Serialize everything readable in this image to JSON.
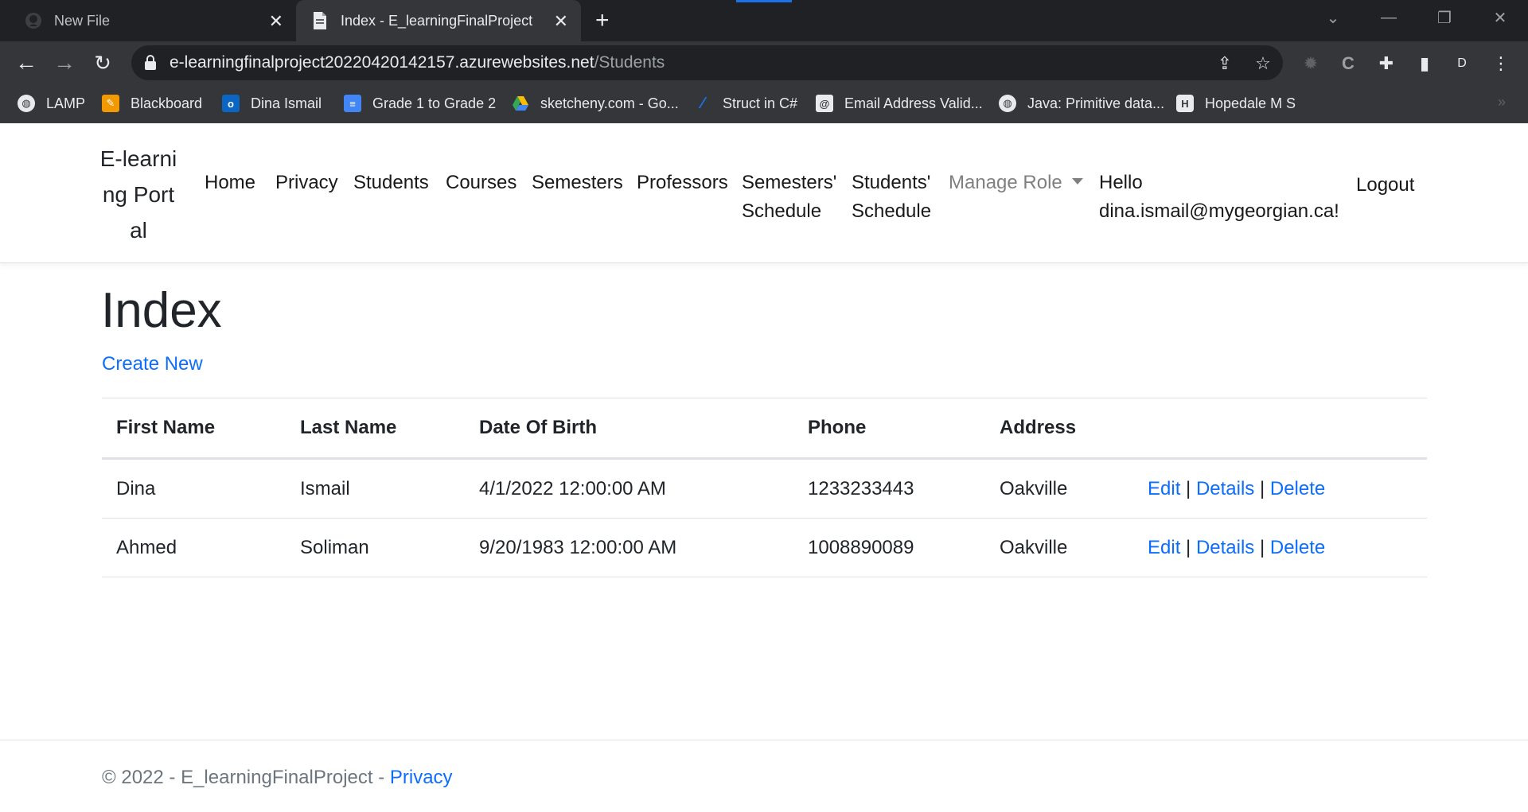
{
  "browser": {
    "tabs": [
      {
        "title": "New File",
        "icon": "github-icon",
        "active": false
      },
      {
        "title": "Index - E_learningFinalProject",
        "icon": "document-icon",
        "active": true
      }
    ],
    "url_host": "e-learningfinalproject20220420142157.azurewebsites.net",
    "url_path": "/Students",
    "profile_initial": "D",
    "bookmarks": [
      {
        "label": "LAMP",
        "icon": "globe-icon",
        "color": "#e8eaed"
      },
      {
        "label": "Blackboard",
        "icon": "pencil-icon",
        "color": "#f29900"
      },
      {
        "label": "Dina Ismail",
        "icon": "outlook-icon",
        "color": "#0a66c2"
      },
      {
        "label": "Grade 1 to Grade 2",
        "icon": "docs-icon",
        "color": "#4285f4"
      },
      {
        "label": "sketcheny.com - Go...",
        "icon": "drive-icon",
        "color": "#34a853"
      },
      {
        "label": "Struct in C#",
        "icon": "feather-icon",
        "color": "#1a73e8"
      },
      {
        "label": "Email Address Valid...",
        "icon": "email-validator-icon",
        "color": "#8ab4f8"
      },
      {
        "label": "Java: Primitive data...",
        "icon": "globe-icon",
        "color": "#e8eaed"
      },
      {
        "label": "Hopedale M S",
        "icon": "hopedale-icon",
        "color": "#e8eaed"
      }
    ]
  },
  "site": {
    "brand": "E-learning Portal",
    "nav": {
      "home": "Home",
      "privacy": "Privacy",
      "students": "Students",
      "courses": "Courses",
      "semesters": "Semesters",
      "professors": "Professors",
      "semesters_schedule": "Semesters' Schedule",
      "students_schedule": "Students' Schedule",
      "manage_role": "Manage Role",
      "hello": "Hello dina.ismail@mygeorgian.ca!",
      "logout": "Logout"
    }
  },
  "main": {
    "title": "Index",
    "create_new": "Create New",
    "columns": [
      "First Name",
      "Last Name",
      "Date Of Birth",
      "Phone",
      "Address"
    ],
    "rows": [
      {
        "first": "Dina",
        "last": "Ismail",
        "dob": "4/1/2022 12:00:00 AM",
        "phone": "1233233443",
        "address": "Oakville"
      },
      {
        "first": "Ahmed",
        "last": "Soliman",
        "dob": "9/20/1983 12:00:00 AM",
        "phone": "1008890089",
        "address": "Oakville"
      }
    ],
    "actions": {
      "edit": "Edit",
      "details": "Details",
      "delete": "Delete",
      "separator": "|"
    }
  },
  "footer": {
    "text": "© 2022 - E_learningFinalProject - ",
    "privacy": "Privacy"
  },
  "colors": {
    "link": "#0d6efd",
    "chrome_dark": "#202124",
    "chrome": "#35363a"
  }
}
